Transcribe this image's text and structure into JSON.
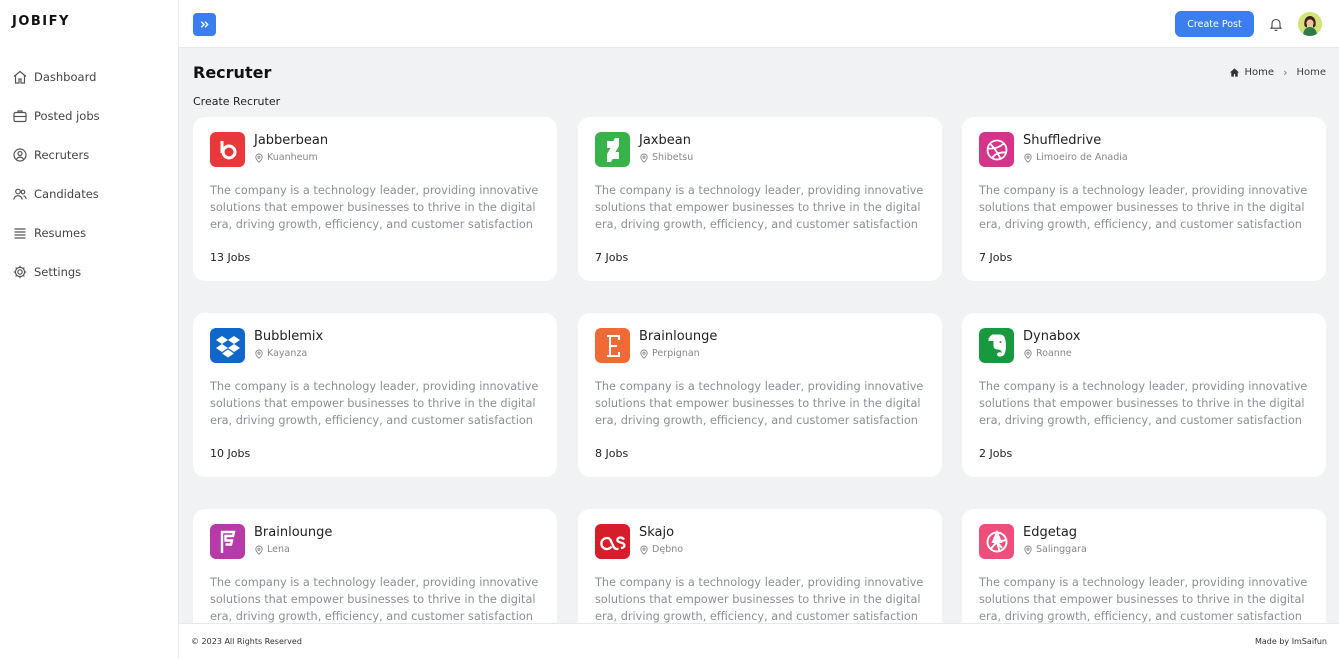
{
  "brand": "JOBIFY",
  "sidebar": {
    "items": [
      {
        "label": "Dashboard",
        "icon": "home-icon"
      },
      {
        "label": "Posted jobs",
        "icon": "briefcase-icon"
      },
      {
        "label": "Recruters",
        "icon": "user-circle-icon"
      },
      {
        "label": "Candidates",
        "icon": "users-icon"
      },
      {
        "label": "Resumes",
        "icon": "list-icon"
      },
      {
        "label": "Settings",
        "icon": "gear-icon"
      }
    ]
  },
  "topbar": {
    "create_label": "Create Post",
    "toggle_icon": "double-chevron-right-icon",
    "bell_icon": "bell-icon"
  },
  "header": {
    "title": "Recruter",
    "subtitle": "Create Recruter",
    "breadcrumb": [
      "Home",
      "Home"
    ]
  },
  "recruiters": [
    {
      "name": "Jabberbean",
      "location": "Kuanheum",
      "jobs": "13 Jobs",
      "color": "#e8383c",
      "icon": "beats-logo-icon"
    },
    {
      "name": "Jaxbean",
      "location": "Shibetsu",
      "jobs": "7 Jobs",
      "color": "#37b34a",
      "icon": "deviantart-logo-icon"
    },
    {
      "name": "Shuffledrive",
      "location": "Limoeiro de Anadia",
      "jobs": "7 Jobs",
      "color": "#d6338a",
      "icon": "dribbble-logo-icon"
    },
    {
      "name": "Bubblemix",
      "location": "Kayanza",
      "jobs": "10 Jobs",
      "color": "#1167c9",
      "icon": "dropbox-logo-icon"
    },
    {
      "name": "Brainlounge",
      "location": "Perpignan",
      "jobs": "8 Jobs",
      "color": "#f06a35",
      "icon": "etsy-logo-icon"
    },
    {
      "name": "Dynabox",
      "location": "Roanne",
      "jobs": "2 Jobs",
      "color": "#179a3f",
      "icon": "evernote-logo-icon"
    },
    {
      "name": "Brainlounge",
      "location": "Lena",
      "jobs": "",
      "color": "#b83aa8",
      "icon": "foursquare-logo-icon"
    },
    {
      "name": "Skajo",
      "location": "Dębno",
      "jobs": "",
      "color": "#d51e2a",
      "icon": "lastfm-logo-icon"
    },
    {
      "name": "Edgetag",
      "location": "Salinggara",
      "jobs": "",
      "color": "#ef4d7c",
      "icon": "picasa-logo-icon"
    }
  ],
  "card_description": "The company is a technology leader, providing innovative solutions that empower businesses to thrive in the digital era, driving growth, efficiency, and customer satisfaction",
  "footer": {
    "copyright": "© 2023 All Rights Reserved",
    "made_by": "Made by ImSaifun"
  }
}
